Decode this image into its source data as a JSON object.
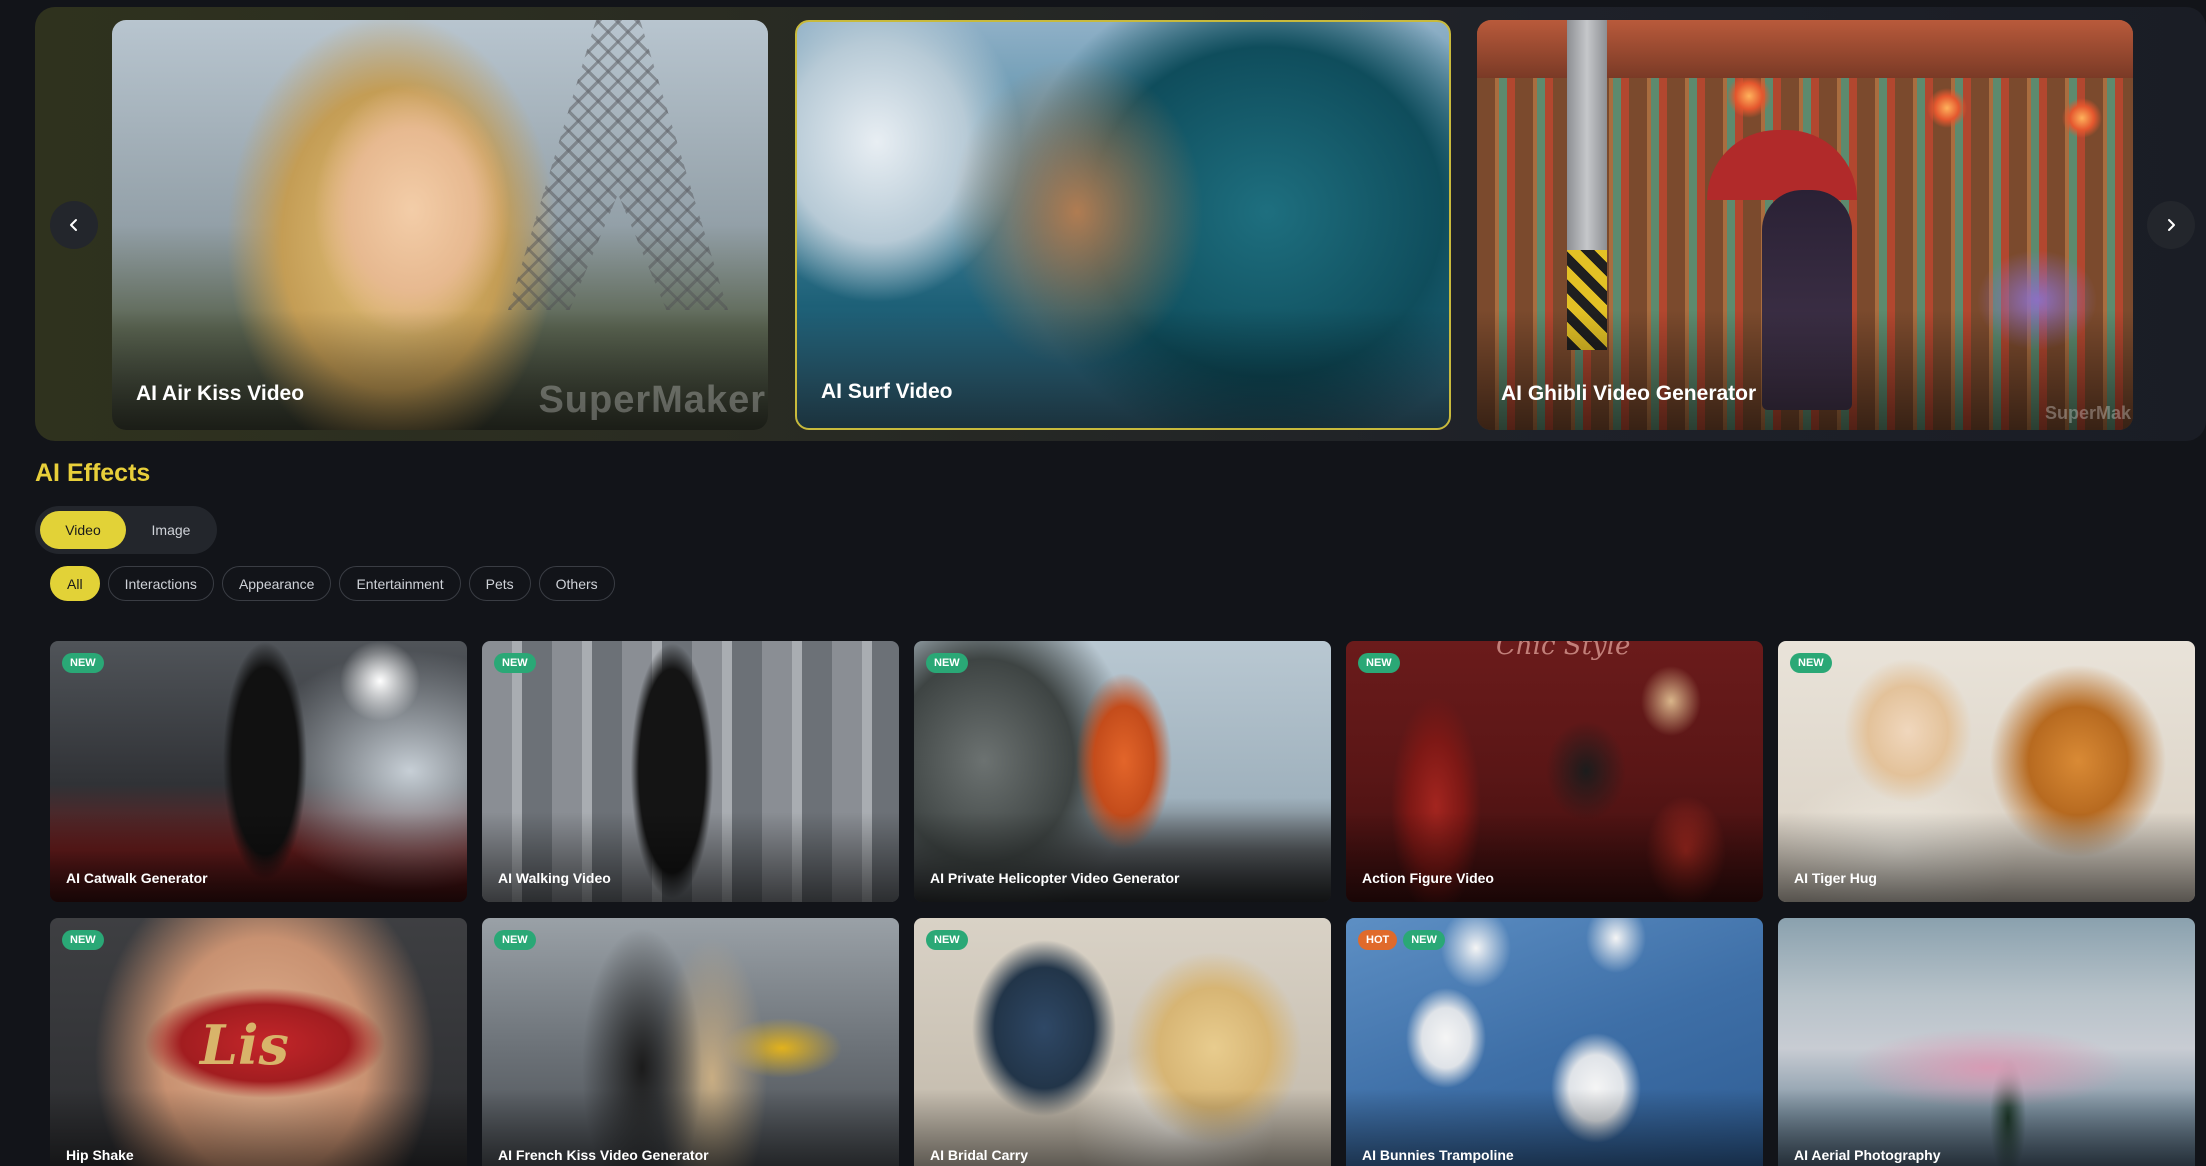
{
  "hero": {
    "cards": [
      {
        "title": "AI Air Kiss Video",
        "watermark": "SuperMaker"
      },
      {
        "title": "AI Surf Video"
      },
      {
        "title": "AI Ghibli Video Generator",
        "watermark": "SuperMak"
      }
    ],
    "prev_icon": "chevron-left-icon",
    "next_icon": "chevron-right-icon"
  },
  "section": {
    "title": "AI Effects",
    "type_toggle": {
      "active": "Video",
      "inactive": "Image"
    },
    "filters": [
      "All",
      "Interactions",
      "Appearance",
      "Entertainment",
      "Pets",
      "Others"
    ],
    "active_filter": "All"
  },
  "cards": [
    {
      "title": "AI Catwalk Generator",
      "badges": [
        "NEW"
      ]
    },
    {
      "title": "AI Walking Video",
      "badges": [
        "NEW"
      ]
    },
    {
      "title": "AI Private Helicopter Video Generator",
      "badges": [
        "NEW"
      ]
    },
    {
      "title": "Action Figure Video",
      "badges": [
        "NEW"
      ],
      "overlay_text": "Chic Style"
    },
    {
      "title": "AI Tiger Hug",
      "badges": [
        "NEW"
      ]
    },
    {
      "title": "Hip Shake",
      "badges": [
        "NEW"
      ],
      "overlay_text": "Lis"
    },
    {
      "title": "AI French Kiss Video Generator",
      "badges": [
        "NEW"
      ]
    },
    {
      "title": "AI Bridal Carry",
      "badges": [
        "NEW"
      ]
    },
    {
      "title": "AI Bunnies Trampoline",
      "badges": [
        "HOT",
        "NEW"
      ]
    },
    {
      "title": "AI Aerial Photography",
      "badges": []
    }
  ],
  "colors": {
    "accent": "#e2d237",
    "accent_text": "#e8cf3a",
    "badge_new": "#2aa876",
    "badge_hot": "#e06a2b",
    "background": "#121419"
  }
}
